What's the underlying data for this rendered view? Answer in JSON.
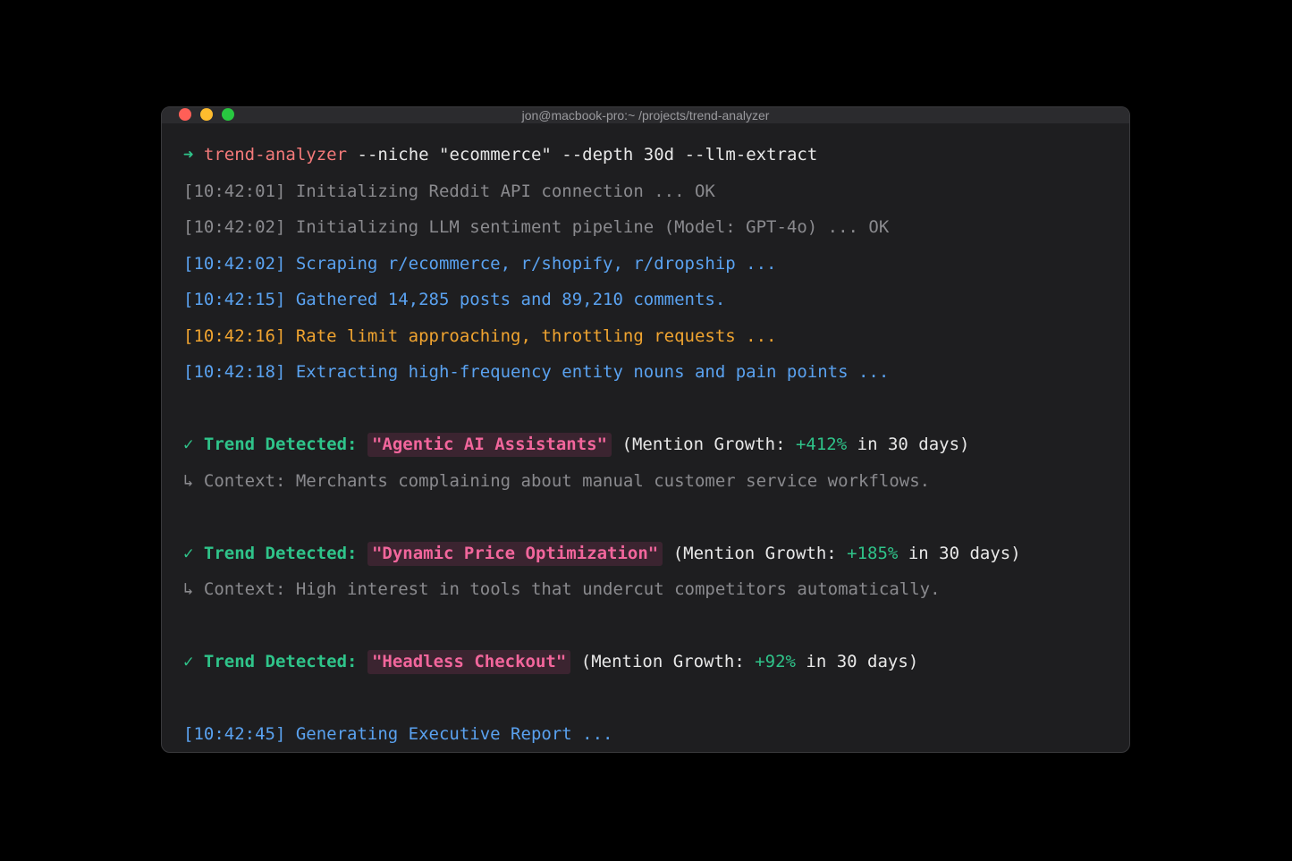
{
  "window": {
    "title": "jon@macbook-pro:~ /projects/trend-analyzer",
    "colors": {
      "close": "#ff5f57",
      "minimize": "#febc2e",
      "zoom": "#28c840"
    }
  },
  "terminal": {
    "command": {
      "prompt_symbol": "➜",
      "program": "trend-analyzer",
      "args": "--niche \"ecommerce\" --depth 30d --llm-extract"
    },
    "logs": [
      {
        "time": "[10:42:01]",
        "message": "Initializing Reddit API connection ... OK"
      },
      {
        "time": "[10:42:02]",
        "message": "Initializing LLM sentiment pipeline (Model: GPT-4o) ... OK"
      },
      {
        "time": "[10:42:02]",
        "message": "Scraping r/ecommerce, r/shopify, r/dropship ..."
      },
      {
        "time": "[10:42:15]",
        "message": "Gathered 14,285 posts and 89,210 comments."
      },
      {
        "time": "[10:42:16]",
        "message": "Rate limit approaching, throttling requests ..."
      },
      {
        "time": "[10:42:18]",
        "message": "Extracting high-frequency entity nouns and pain points ..."
      }
    ],
    "trends": [
      {
        "check": "✓",
        "label": "Trend Detected:",
        "name": "\"Agentic AI Assistants\"",
        "growth_prefix": "(Mention Growth: ",
        "growth": "+412%",
        "growth_suffix": " in 30 days)",
        "context_arrow": "↳",
        "context": "Context: Merchants complaining about manual customer service workflows."
      },
      {
        "check": "✓",
        "label": "Trend Detected:",
        "name": "\"Dynamic Price Optimization\"",
        "growth_prefix": "(Mention Growth: ",
        "growth": "+185%",
        "growth_suffix": " in 30 days)",
        "context_arrow": "↳",
        "context": "Context: High interest in tools that undercut competitors automatically."
      },
      {
        "check": "✓",
        "label": "Trend Detected:",
        "name": "\"Headless Checkout\"",
        "growth_prefix": "(Mention Growth: ",
        "growth": "+92%",
        "growth_suffix": " in 30 days)"
      }
    ],
    "final": {
      "time": "[10:42:45]",
      "message": "Generating Executive Report ..."
    }
  }
}
